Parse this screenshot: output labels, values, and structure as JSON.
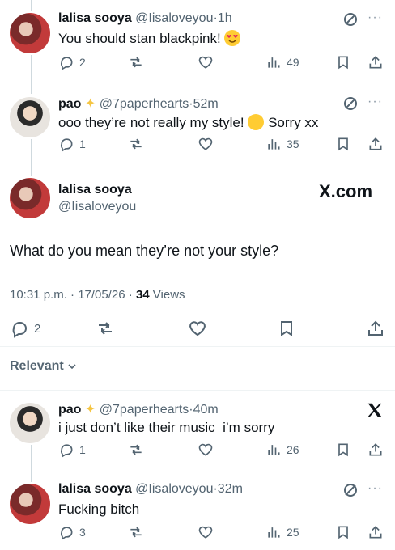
{
  "tweets": [
    {
      "name": "lalisa sooya",
      "handle": "@Iisaloveyou",
      "time": "1h",
      "text": "You should stan blackpink!",
      "replies": "2",
      "views": "49"
    },
    {
      "name": "pao",
      "handle": "@7paperhearts",
      "time": "52m",
      "text_before": "ooo they’re not really my style!",
      "text_after": "Sorry xx",
      "replies": "1",
      "views": "35"
    }
  ],
  "main": {
    "name": "lalisa sooya",
    "handle": "@Iisaloveyou",
    "brand": "X.com",
    "text": "What do you mean they’re not your style?",
    "meta_time": "10:31 p.m. · 17/05/26 · ",
    "views_count": "34",
    "views_label": " Views",
    "replies": "2"
  },
  "relevant_label": "Relevant",
  "replies": [
    {
      "name": "pao",
      "handle": "@7paperhearts",
      "time": "40m",
      "text": "i just don’t like their music  i’m sorry",
      "replies": "1",
      "views": "26"
    },
    {
      "name": "lalisa sooya",
      "handle": "@Iisaloveyou",
      "time": "32m",
      "text": "Fucking bitch",
      "replies": "3",
      "views": "25"
    }
  ],
  "separator": "·",
  "more_dots": "···"
}
